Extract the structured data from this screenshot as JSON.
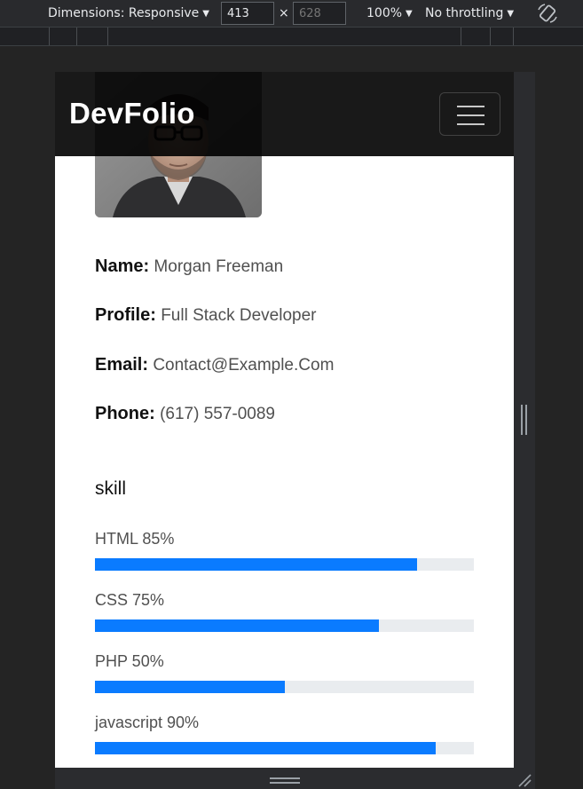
{
  "devtools": {
    "dimensions_label": "Dimensions: Responsive",
    "width_value": "413",
    "height_placeholder": "628",
    "times": "×",
    "zoom": "100%",
    "throttling": "No throttling"
  },
  "navbar": {
    "brand": "DevFolio"
  },
  "profile": {
    "name_label": "Name:",
    "name_value": "Morgan Freeman",
    "profile_label": "Profile:",
    "profile_value": "Full Stack Developer",
    "email_label": "Email:",
    "email_value": "Contact@Example.Com",
    "phone_label": "Phone:",
    "phone_value": "(617) 557-0089"
  },
  "skills": {
    "title": "skill",
    "items": [
      {
        "label": "HTML 85%",
        "percent": 85
      },
      {
        "label": "CSS 75%",
        "percent": 75
      },
      {
        "label": "PHP 50%",
        "percent": 50
      },
      {
        "label": "javascript 90%",
        "percent": 90
      }
    ]
  },
  "colors": {
    "progress_fill": "#0a7bff",
    "progress_track": "#e9ecef",
    "navbar_bg": "#000000"
  }
}
